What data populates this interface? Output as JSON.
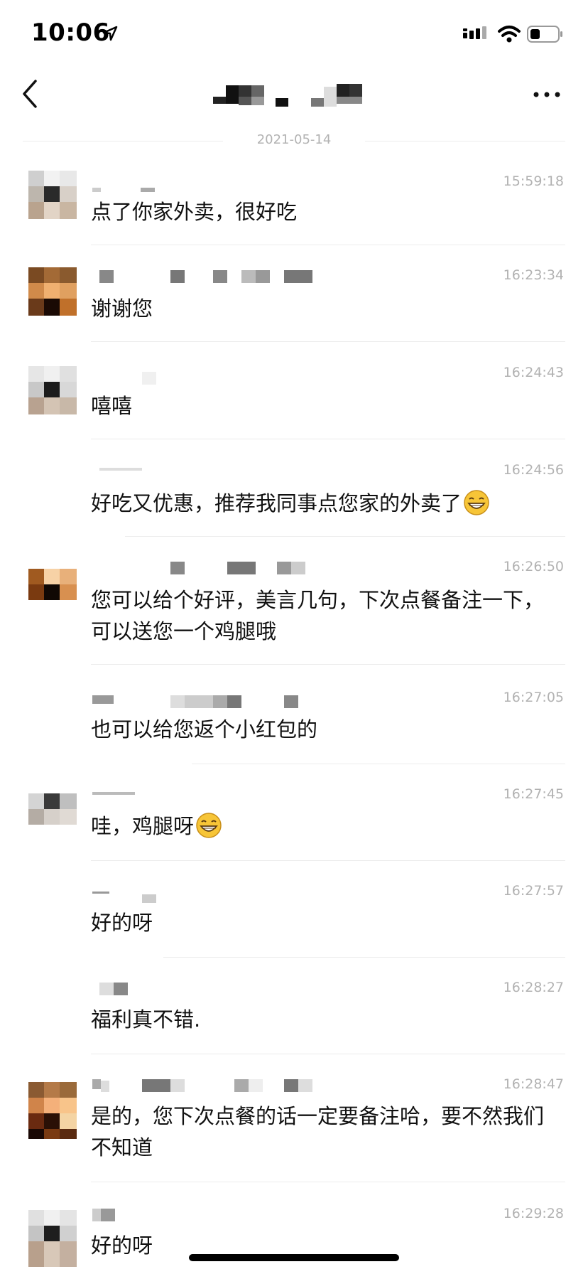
{
  "status_bar": {
    "time": "10:06"
  },
  "date_divider": "2021-05-14",
  "messages": [
    {
      "time": "15:59:18",
      "text": "点了你家外卖，很好吃"
    },
    {
      "time": "16:23:34",
      "text": "谢谢您"
    },
    {
      "time": "16:24:43",
      "text": "嘻嘻"
    },
    {
      "time": "16:24:56",
      "text": "好吃又优惠，推荐我同事点您家的外卖了",
      "emoji": "grinning-face-emoji"
    },
    {
      "time": "16:26:50",
      "text": "您可以给个好评，美言几句，下次点餐备注一下，可以送您一个鸡腿哦"
    },
    {
      "time": "16:27:05",
      "text": "也可以给您返个小红包的"
    },
    {
      "time": "16:27:45",
      "text": "哇，鸡腿呀",
      "emoji": "grinning-face-emoji"
    },
    {
      "time": "16:27:57",
      "text": "好的呀"
    },
    {
      "time": "16:28:27",
      "text": "福利真不错."
    },
    {
      "time": "16:28:47",
      "text": "是的，您下次点餐的话一定要备注哈，要不然我们不知道"
    },
    {
      "time": "16:29:28",
      "text": "好的呀"
    }
  ]
}
